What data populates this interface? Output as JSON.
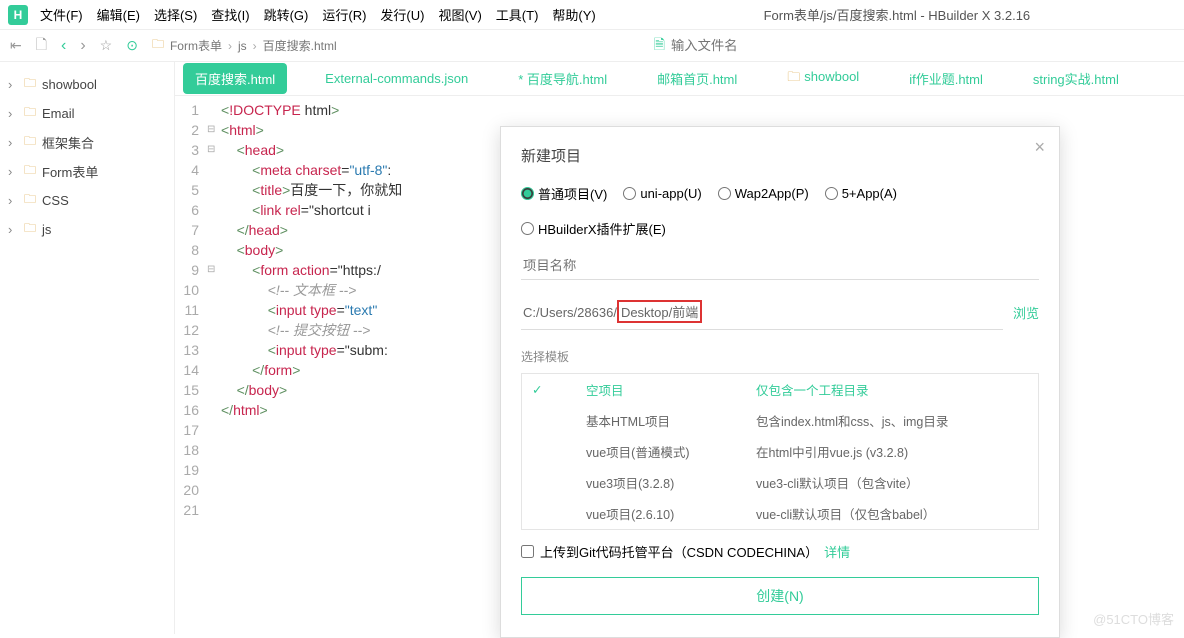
{
  "app": {
    "logo": "H",
    "title": "Form表单/js/百度搜索.html - HBuilder X 3.2.16"
  },
  "menu": {
    "file": "文件(F)",
    "edit": "编辑(E)",
    "select": "选择(S)",
    "find": "查找(I)",
    "goto": "跳转(G)",
    "run": "运行(R)",
    "release": "发行(U)",
    "view": "视图(V)",
    "tool": "工具(T)",
    "help": "帮助(Y)"
  },
  "breadcrumb": {
    "root": "Form表单",
    "dir": "js",
    "file": "百度搜索.html"
  },
  "filepath_placeholder": "输入文件名",
  "tree": {
    "items": [
      {
        "label": "showbool"
      },
      {
        "label": "Email"
      },
      {
        "label": "框架集合"
      },
      {
        "label": "Form表单"
      },
      {
        "label": "CSS"
      },
      {
        "label": "js"
      }
    ]
  },
  "tabs": [
    {
      "label": "百度搜索.html",
      "active": true
    },
    {
      "label": "External-commands.json"
    },
    {
      "label": "* 百度导航.html"
    },
    {
      "label": "邮箱首页.html"
    },
    {
      "label": "showbool",
      "folder": true
    },
    {
      "label": "if作业题.html"
    },
    {
      "label": "string实战.html"
    }
  ],
  "code": {
    "lines": [
      "<!DOCTYPE html>",
      "<html>",
      "    <head>",
      "        <meta charset=\"utf-8\":",
      "        <title>百度一下，你就知",
      "        <link rel=\"shortcut i",
      "    </head>",
      "    <body>",
      "        <form action=\"https:/",
      "            <!-- 文本框 -->",
      "            <input type=\"text\"",
      "            <!-- 提交按钮 -->",
      "            <input type=\"subm:",
      "        </form>",
      "    </body>",
      "</html>",
      "",
      "",
      "",
      "",
      ""
    ],
    "fold": {
      "2": "⊟",
      "3": "⊟",
      "9": "⊟"
    }
  },
  "dialog": {
    "title": "新建项目",
    "types": [
      {
        "label": "普通项目(V)",
        "checked": true
      },
      {
        "label": "uni-app(U)"
      },
      {
        "label": "Wap2App(P)"
      },
      {
        "label": "5+App(A)"
      },
      {
        "label": "HBuilderX插件扩展(E)"
      }
    ],
    "name_placeholder": "项目名称",
    "path_a": "C:/Users/28636/",
    "path_b": "Desktop/前端",
    "browse": "浏览",
    "section": "选择模板",
    "templates": [
      {
        "name": "空项目",
        "desc": "仅包含一个工程目录",
        "sel": true
      },
      {
        "name": "基本HTML项目",
        "desc": "包含index.html和css、js、img目录"
      },
      {
        "name": "vue项目(普通模式)",
        "desc": "在html中引用vue.js (v3.2.8)"
      },
      {
        "name": "vue3项目(3.2.8)",
        "desc": "vue3-cli默认项目（包含vite）"
      },
      {
        "name": "vue项目(2.6.10)",
        "desc": "vue-cli默认项目（仅包含babel）"
      }
    ],
    "git": "上传到Git代码托管平台（CSDN CODECHINA）",
    "git_detail": "详情",
    "create": "创建(N)"
  },
  "watermark": "@51CTO博客"
}
